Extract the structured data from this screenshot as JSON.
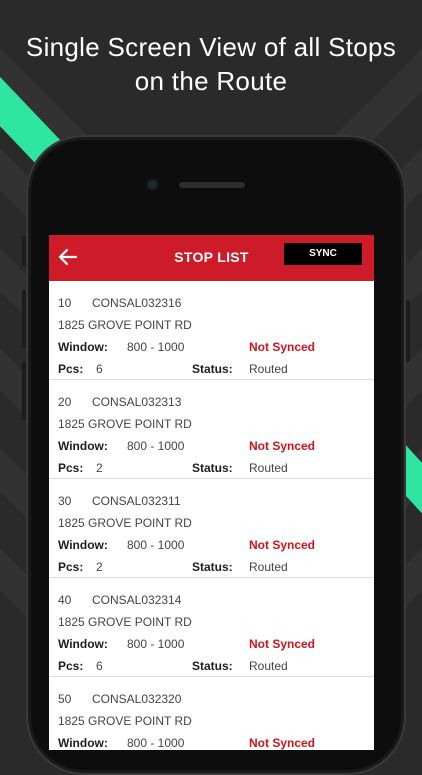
{
  "headline": {
    "line1": "Single Screen View of all Stops",
    "line2": "on the Route"
  },
  "colors": {
    "accent_red": "#ce1b2a",
    "status_red": "#d0121b",
    "background": "#2a2a2b",
    "stripe_green": "#2ee6a0"
  },
  "appbar": {
    "back_icon": "arrow-left-icon",
    "title": "STOP LIST",
    "sync_label": "SYNC"
  },
  "labels": {
    "window": "Window:",
    "pcs": "Pcs:",
    "status": "Status:"
  },
  "stops": [
    {
      "seq": "10",
      "code": "CONSAL032316",
      "address": "1825 GROVE POINT RD",
      "window": "800 - 1000",
      "sync_status": "Not Synced",
      "pcs": "6",
      "status": "Routed"
    },
    {
      "seq": "20",
      "code": "CONSAL032313",
      "address": "1825 GROVE POINT RD",
      "window": "800 - 1000",
      "sync_status": "Not Synced",
      "pcs": "2",
      "status": "Routed"
    },
    {
      "seq": "30",
      "code": "CONSAL032311",
      "address": "1825 GROVE POINT RD",
      "window": "800 - 1000",
      "sync_status": "Not Synced",
      "pcs": "2",
      "status": "Routed"
    },
    {
      "seq": "40",
      "code": "CONSAL032314",
      "address": "1825 GROVE POINT RD",
      "window": "800 - 1000",
      "sync_status": "Not Synced",
      "pcs": "6",
      "status": "Routed"
    },
    {
      "seq": "50",
      "code": "CONSAL032320",
      "address": "1825 GROVE POINT RD",
      "window": "800 - 1000",
      "sync_status": "Not Synced",
      "pcs": "",
      "status": ""
    }
  ]
}
